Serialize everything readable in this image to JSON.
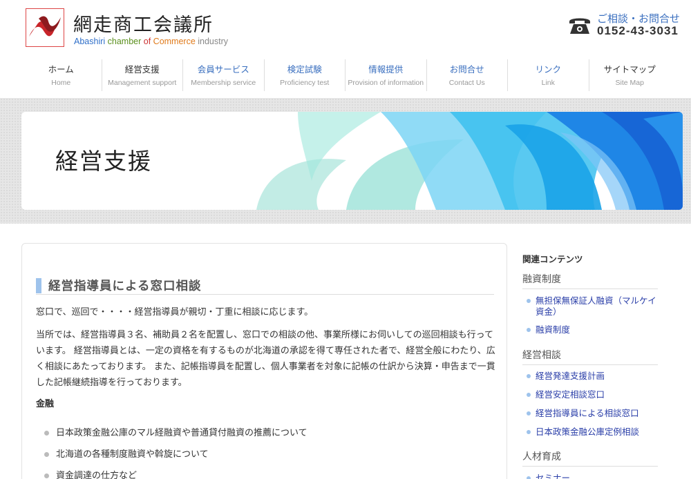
{
  "header": {
    "logo_title": "網走商工会議所",
    "logo_sub": [
      "Abashiri",
      " chamber",
      " of",
      " Commerce",
      " industry"
    ],
    "contact_label": "ご相談・お問合せ",
    "contact_number": "0152-43-3031"
  },
  "nav": {
    "items": [
      {
        "jp": "ホーム",
        "en": "Home"
      },
      {
        "jp": "経営支援",
        "en": "Management support"
      },
      {
        "jp": "会員サービス",
        "en": "Membership service"
      },
      {
        "jp": "検定試験",
        "en": "Proficiency test"
      },
      {
        "jp": "情報提供",
        "en": "Provision of information"
      },
      {
        "jp": "お問合せ",
        "en": "Contact Us"
      },
      {
        "jp": "リンク",
        "en": "Link"
      },
      {
        "jp": "サイトマップ",
        "en": "Site Map"
      }
    ]
  },
  "banner": {
    "title": "経営支援"
  },
  "main": {
    "heading": "経営指導員による窓口相談",
    "lead": "窓口で、巡回で・・・・経営指導員が親切・丁重に相談に応じます。",
    "paragraph": "当所では、経営指導員３名、補助員２名を配置し、窓口での相談の他、事業所様にお伺いしての巡回相談も行っています。 経営指導員とは、一定の資格を有するものが北海道の承認を得て専任された者で、経営全般にわたり、広く相談にあたっております。 また、記帳指導員を配置し、個人事業者を対象に記帳の仕訳から決算・申告まで一貫した記帳継続指導を行っております。",
    "sub_heading": "金融",
    "list": [
      "日本政策金融公庫のマル経融資や普通貸付融資の推薦について",
      "北海道の各種制度融資や斡旋について",
      "資金調達の仕方など"
    ]
  },
  "sidebar": {
    "title": "関連コンテンツ",
    "categories": [
      {
        "label": "融資制度",
        "links": [
          "無担保無保証人融資（マルケイ資金）",
          "融資制度"
        ]
      },
      {
        "label": "経営相談",
        "links": [
          "経営発達支援計画",
          "経営安定相談窓口",
          "経営指導員による相談窓口",
          "日本政策金融公庫定例相談"
        ]
      },
      {
        "label": "人材育成",
        "links": [
          "セミナー"
        ]
      }
    ]
  }
}
